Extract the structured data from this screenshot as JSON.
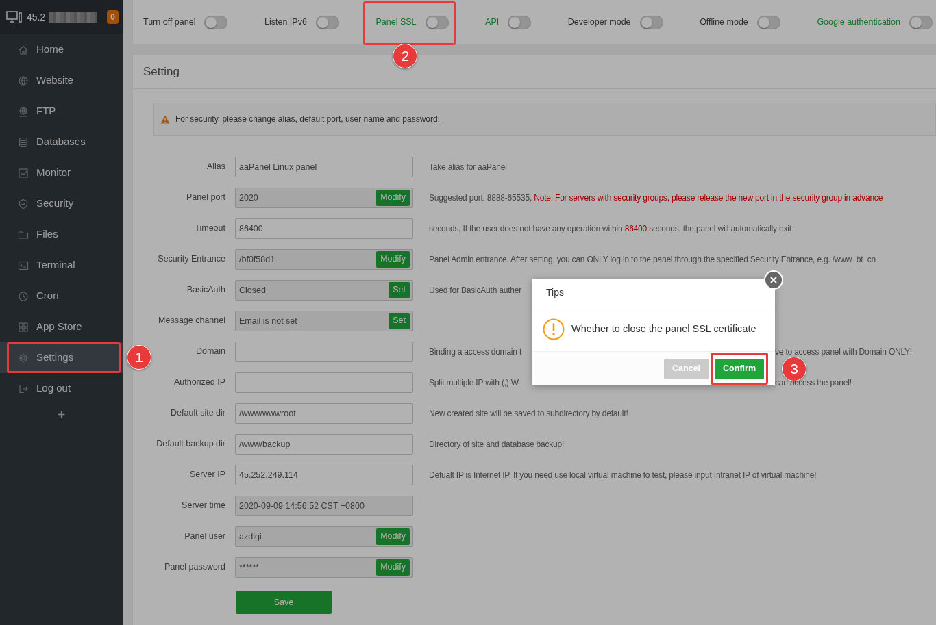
{
  "header": {
    "server_ip": "45.2",
    "badge": "0"
  },
  "sidebar": {
    "items": [
      {
        "label": "Home",
        "selected": false
      },
      {
        "label": "Website",
        "selected": false
      },
      {
        "label": "FTP",
        "selected": false
      },
      {
        "label": "Databases",
        "selected": false
      },
      {
        "label": "Monitor",
        "selected": false
      },
      {
        "label": "Security",
        "selected": false
      },
      {
        "label": "Files",
        "selected": false
      },
      {
        "label": "Terminal",
        "selected": false
      },
      {
        "label": "Cron",
        "selected": false
      },
      {
        "label": "App Store",
        "selected": false
      },
      {
        "label": "Settings",
        "selected": true,
        "callout": "1"
      },
      {
        "label": "Log out",
        "selected": false
      }
    ],
    "add_button": "+"
  },
  "toggles": [
    {
      "label": "Turn off panel",
      "on": false,
      "highlighted": false
    },
    {
      "label": "Listen IPv6",
      "on": false,
      "highlighted": false
    },
    {
      "label": "Panel SSL",
      "on": false,
      "highlighted": true,
      "callout": "2"
    },
    {
      "label": "API",
      "on": false,
      "highlighted": true
    },
    {
      "label": "Developer mode",
      "on": false,
      "highlighted": false
    },
    {
      "label": "Offline mode",
      "on": false,
      "highlighted": false
    },
    {
      "label": "Google authentication",
      "on": false,
      "highlighted": true
    }
  ],
  "settings": {
    "title": "Setting",
    "alert": "For security, please change alias, default port, user name and password!",
    "fields": [
      {
        "label": "Alias",
        "value": "aaPanel Linux panel",
        "readonly": false,
        "description": [
          {
            "text": "Take alias for aaPanel",
            "red": false
          }
        ]
      },
      {
        "label": "Panel port",
        "value": "2020",
        "readonly": true,
        "button": "Modify",
        "description": [
          {
            "text": "Suggested port: 8888-65535, ",
            "red": false
          },
          {
            "text": "Note: For servers with security groups, please release the new port in the security group in advance",
            "red": true
          }
        ]
      },
      {
        "label": "Timeout",
        "value": "86400",
        "readonly": false,
        "description": [
          {
            "text": "seconds, If the user does not have any operation within ",
            "red": false
          },
          {
            "text": "86400",
            "red": true
          },
          {
            "text": " seconds, the panel will automatically exit",
            "red": false
          }
        ]
      },
      {
        "label": "Security Entrance",
        "value": "/bf0f58d1",
        "readonly": true,
        "button": "Modify",
        "description": [
          {
            "text": "Panel Admin entrance. After setting, you can ONLY log in to the panel through the specified Security Entrance, e.g. /www_bt_cn",
            "red": false
          }
        ]
      },
      {
        "label": "BasicAuth",
        "value": "Closed",
        "readonly": true,
        "button": "Set",
        "description": [
          {
            "text": "Used for BasicAuth auther",
            "red": false
          }
        ]
      },
      {
        "label": "Message channel",
        "value": "Email is not set",
        "readonly": true,
        "button": "Set"
      },
      {
        "label": "Domain",
        "readonly": false,
        "description": [
          {
            "text": "Binding a access domain t",
            "red": false
          }
        ],
        "description_after_dialog": "ve to access panel with Domain ONLY!"
      },
      {
        "label": "Authorized IP",
        "readonly": false,
        "description": [
          {
            "text": "Split multiple IP with (,) W",
            "red": false
          }
        ],
        "description_after_dialog": "can access the panel!"
      },
      {
        "label": "Default site dir",
        "value": "/www/wwwroot",
        "readonly": false,
        "description": [
          {
            "text": "New created site will be saved to subdirectory by default!",
            "red": false
          }
        ]
      },
      {
        "label": "Default backup dir",
        "value": "/www/backup",
        "readonly": false,
        "description": [
          {
            "text": "Directory of site and database backup!",
            "red": false
          }
        ]
      },
      {
        "label": "Server IP",
        "value": "45.252.249.114",
        "readonly": false,
        "description": [
          {
            "text": "Defualt IP is Internet IP. If you need use local virtual machine to test, please input Intranet IP of virtual machine!",
            "red": false
          }
        ]
      },
      {
        "label": "Server time",
        "value": "2020-09-09 14:56:52 CST +0800",
        "readonly": true
      },
      {
        "label": "Panel user",
        "value": "azdigi",
        "readonly": true,
        "button": "Modify"
      },
      {
        "label": "Panel password",
        "value": "******",
        "readonly": true,
        "button": "Modify"
      }
    ],
    "save_button": "Save"
  },
  "dialog": {
    "title": "Tips",
    "message": "Whether to close the panel SSL certificate",
    "buttons": [
      {
        "label": "Cancel",
        "kind": "secondary"
      },
      {
        "label": "Confirm",
        "kind": "primary",
        "callout": "3"
      }
    ]
  }
}
